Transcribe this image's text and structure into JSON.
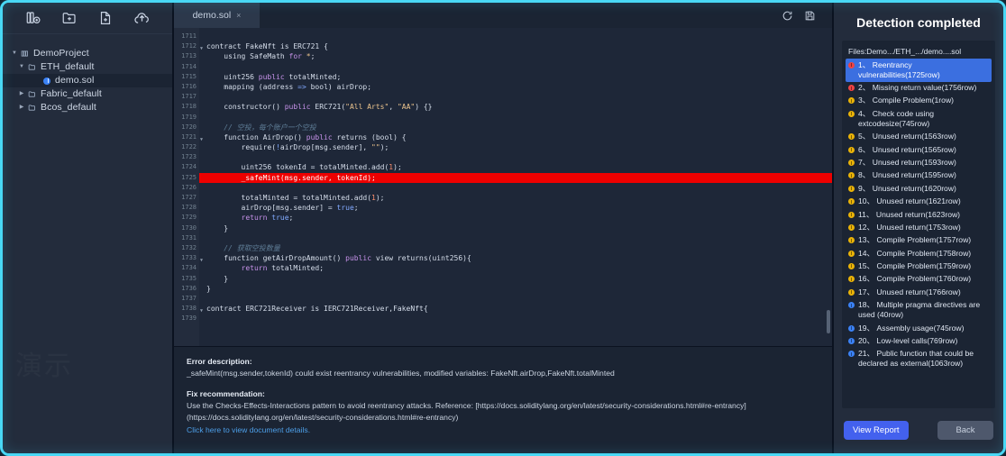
{
  "sidebar": {
    "toolbar_icons": [
      {
        "name": "new-project-icon",
        "label": "New Project"
      },
      {
        "name": "new-folder-icon",
        "label": "New Folder"
      },
      {
        "name": "new-file-icon",
        "label": "New File"
      },
      {
        "name": "upload-cloud-icon",
        "label": "Upload"
      }
    ],
    "tree": [
      {
        "label": "DemoProject",
        "depth": 0,
        "arrow": "▼",
        "icon": "project-icon",
        "selected": false
      },
      {
        "label": "ETH_default",
        "depth": 1,
        "arrow": "▼",
        "icon": "folder-icon",
        "selected": false
      },
      {
        "label": "demo.sol",
        "depth": 2,
        "arrow": "",
        "icon": "sol-file-icon",
        "selected": true
      },
      {
        "label": "Fabric_default",
        "depth": 1,
        "arrow": "▶",
        "icon": "folder-icon",
        "selected": false
      },
      {
        "label": "Bcos_default",
        "depth": 1,
        "arrow": "▶",
        "icon": "folder-icon",
        "selected": false
      }
    ],
    "watermark": "演示"
  },
  "editor": {
    "tab": {
      "label": "demo.sol",
      "close": "×"
    },
    "actions": [
      {
        "name": "refresh-icon",
        "label": "Refresh"
      },
      {
        "name": "save-icon",
        "label": "Save"
      }
    ],
    "first_line_number": 1711,
    "highlighted_line": 1725,
    "lines": [
      {
        "n": 1711,
        "fold": false,
        "tokens": []
      },
      {
        "n": 1712,
        "fold": true,
        "tokens": [
          {
            "t": "contract ",
            "c": "fn"
          },
          {
            "t": "FakeNft",
            "c": "fn"
          },
          {
            "t": " is ",
            "c": "fn"
          },
          {
            "t": "ERC721",
            "c": "fn"
          },
          {
            "t": " {",
            "c": "pun"
          }
        ]
      },
      {
        "n": 1713,
        "fold": false,
        "tokens": [
          {
            "t": "    using SafeMath ",
            "c": "fn"
          },
          {
            "t": "for",
            "c": "kw"
          },
          {
            "t": " ",
            "c": "fn"
          },
          {
            "t": "*",
            "c": "str"
          },
          {
            "t": ";",
            "c": "pun"
          }
        ]
      },
      {
        "n": 1714,
        "fold": false,
        "tokens": []
      },
      {
        "n": 1715,
        "fold": false,
        "tokens": [
          {
            "t": "    uint256 ",
            "c": "fn"
          },
          {
            "t": "public",
            "c": "kw"
          },
          {
            "t": " totalMinted;",
            "c": "fn"
          }
        ]
      },
      {
        "n": 1716,
        "fold": false,
        "tokens": [
          {
            "t": "    mapping (address ",
            "c": "fn"
          },
          {
            "t": "=>",
            "c": "kw2"
          },
          {
            "t": " bool) airDrop;",
            "c": "fn"
          }
        ]
      },
      {
        "n": 1717,
        "fold": false,
        "tokens": []
      },
      {
        "n": 1718,
        "fold": false,
        "tokens": [
          {
            "t": "    constructor() ",
            "c": "fn"
          },
          {
            "t": "public",
            "c": "kw"
          },
          {
            "t": " ERC721(",
            "c": "fn"
          },
          {
            "t": "\"All Arts\"",
            "c": "str"
          },
          {
            "t": ", ",
            "c": "fn"
          },
          {
            "t": "\"AA\"",
            "c": "str"
          },
          {
            "t": ") {}",
            "c": "fn"
          }
        ]
      },
      {
        "n": 1719,
        "fold": false,
        "tokens": []
      },
      {
        "n": 1720,
        "fold": false,
        "tokens": [
          {
            "t": "    // 空投，每个账户一个空投",
            "c": "cmt"
          }
        ]
      },
      {
        "n": 1721,
        "fold": true,
        "tokens": [
          {
            "t": "    function AirDrop() ",
            "c": "fn"
          },
          {
            "t": "public",
            "c": "kw"
          },
          {
            "t": " returns (bool) {",
            "c": "fn"
          }
        ]
      },
      {
        "n": 1722,
        "fold": false,
        "tokens": [
          {
            "t": "        require(",
            "c": "fn"
          },
          {
            "t": "!",
            "c": "kw2"
          },
          {
            "t": "airDrop[msg.sender], ",
            "c": "fn"
          },
          {
            "t": "\"\"",
            "c": "str"
          },
          {
            "t": ");",
            "c": "pun"
          }
        ]
      },
      {
        "n": 1723,
        "fold": false,
        "tokens": []
      },
      {
        "n": 1724,
        "fold": false,
        "tokens": [
          {
            "t": "        uint256 tokenId = totalMinted.add(",
            "c": "fn"
          },
          {
            "t": "1",
            "c": "num"
          },
          {
            "t": ");",
            "c": "pun"
          }
        ]
      },
      {
        "n": 1725,
        "fold": false,
        "tokens": [
          {
            "t": "        _safeMint(msg.sender, tokenId);",
            "c": "fn"
          }
        ]
      },
      {
        "n": 1726,
        "fold": false,
        "tokens": []
      },
      {
        "n": 1727,
        "fold": false,
        "tokens": [
          {
            "t": "        totalMinted = totalMinted.add(",
            "c": "fn"
          },
          {
            "t": "1",
            "c": "num"
          },
          {
            "t": ");",
            "c": "pun"
          }
        ]
      },
      {
        "n": 1728,
        "fold": false,
        "tokens": [
          {
            "t": "        airDrop[msg.sender] = ",
            "c": "fn"
          },
          {
            "t": "true",
            "c": "kw2"
          },
          {
            "t": ";",
            "c": "pun"
          }
        ]
      },
      {
        "n": 1729,
        "fold": false,
        "tokens": [
          {
            "t": "        ",
            "c": "fn"
          },
          {
            "t": "return",
            "c": "kw"
          },
          {
            "t": " ",
            "c": "fn"
          },
          {
            "t": "true",
            "c": "kw2"
          },
          {
            "t": ";",
            "c": "pun"
          }
        ]
      },
      {
        "n": 1730,
        "fold": false,
        "tokens": [
          {
            "t": "    }",
            "c": "pun"
          }
        ]
      },
      {
        "n": 1731,
        "fold": false,
        "tokens": []
      },
      {
        "n": 1732,
        "fold": false,
        "tokens": [
          {
            "t": "    // 获取空投数量",
            "c": "cmt"
          }
        ]
      },
      {
        "n": 1733,
        "fold": true,
        "tokens": [
          {
            "t": "    function getAirDropAmount() ",
            "c": "fn"
          },
          {
            "t": "public",
            "c": "kw"
          },
          {
            "t": " view returns(uint256){",
            "c": "fn"
          }
        ]
      },
      {
        "n": 1734,
        "fold": false,
        "tokens": [
          {
            "t": "        ",
            "c": "fn"
          },
          {
            "t": "return",
            "c": "kw"
          },
          {
            "t": " totalMinted;",
            "c": "fn"
          }
        ]
      },
      {
        "n": 1735,
        "fold": false,
        "tokens": [
          {
            "t": "    }",
            "c": "pun"
          }
        ]
      },
      {
        "n": 1736,
        "fold": false,
        "tokens": [
          {
            "t": "}",
            "c": "pun"
          }
        ]
      },
      {
        "n": 1737,
        "fold": false,
        "tokens": []
      },
      {
        "n": 1738,
        "fold": true,
        "tokens": [
          {
            "t": "contract ERC721Receiver is IERC721Receiver,FakeNft{",
            "c": "fn"
          }
        ]
      },
      {
        "n": 1739,
        "fold": false,
        "tokens": []
      }
    ]
  },
  "description": {
    "error_heading": "Error description:",
    "error_body": "_safeMint(msg.sender,tokenId) could exist reentrancy vulnerabilities, modified variables: FakeNft.airDrop,FakeNft.totalMinted",
    "fix_heading": "Fix recommendation:",
    "fix_body_line1": "Use the Checks-Effects-Interactions pattern to avoid reentrancy attacks. Reference: [https://docs.soliditylang.org/en/latest/security-considerations.html#re-entrancy]",
    "fix_body_line2": "(https://docs.soliditylang.org/en/latest/security-considerations.html#re-entrancy)",
    "doc_link": "Click here to view document details."
  },
  "results": {
    "title": "Detection completed",
    "files_line": "Files:Demo.../ETH_.../demo....sol",
    "items": [
      {
        "num": "1、",
        "text": "Reentrancy vulnerabilities(1725row)",
        "severity": "high",
        "selected": true
      },
      {
        "num": "2、",
        "text": "Missing return value(1756row)",
        "severity": "high",
        "selected": false
      },
      {
        "num": "3、",
        "text": "Compile Problem(1row)",
        "severity": "medium",
        "selected": false
      },
      {
        "num": "4、",
        "text": "Check code using extcodesize(745row)",
        "severity": "medium",
        "selected": false
      },
      {
        "num": "5、",
        "text": "Unused return(1563row)",
        "severity": "medium",
        "selected": false
      },
      {
        "num": "6、",
        "text": "Unused return(1565row)",
        "severity": "medium",
        "selected": false
      },
      {
        "num": "7、",
        "text": "Unused return(1593row)",
        "severity": "medium",
        "selected": false
      },
      {
        "num": "8、",
        "text": "Unused return(1595row)",
        "severity": "medium",
        "selected": false
      },
      {
        "num": "9、",
        "text": "Unused return(1620row)",
        "severity": "medium",
        "selected": false
      },
      {
        "num": "10、",
        "text": "Unused return(1621row)",
        "severity": "medium",
        "selected": false
      },
      {
        "num": "11、",
        "text": "Unused return(1623row)",
        "severity": "medium",
        "selected": false
      },
      {
        "num": "12、",
        "text": "Unused return(1753row)",
        "severity": "medium",
        "selected": false
      },
      {
        "num": "13、",
        "text": "Compile Problem(1757row)",
        "severity": "medium",
        "selected": false
      },
      {
        "num": "14、",
        "text": "Compile Problem(1758row)",
        "severity": "medium",
        "selected": false
      },
      {
        "num": "15、",
        "text": "Compile Problem(1759row)",
        "severity": "medium",
        "selected": false
      },
      {
        "num": "16、",
        "text": "Compile Problem(1760row)",
        "severity": "medium",
        "selected": false
      },
      {
        "num": "17、",
        "text": "Unused return(1766row)",
        "severity": "medium",
        "selected": false
      },
      {
        "num": "18、",
        "text": "Multiple pragma directives are used (40row)",
        "severity": "low",
        "selected": false
      },
      {
        "num": "19、",
        "text": "Assembly usage(745row)",
        "severity": "low",
        "selected": false
      },
      {
        "num": "20、",
        "text": "Low-level calls(769row)",
        "severity": "low",
        "selected": false
      },
      {
        "num": "21、",
        "text": "Public function that could be declared as external(1063row)",
        "severity": "low",
        "selected": false
      }
    ],
    "view_report_label": "View Report",
    "back_label": "Back"
  },
  "colors": {
    "frame_glow": "#49d8f5",
    "selected_item": "#3b6fe0",
    "primary_button": "#4361ee",
    "severity_high": "#ef4444",
    "severity_medium": "#eab308",
    "severity_low": "#3b82f6",
    "error_line": "#ee0000"
  }
}
